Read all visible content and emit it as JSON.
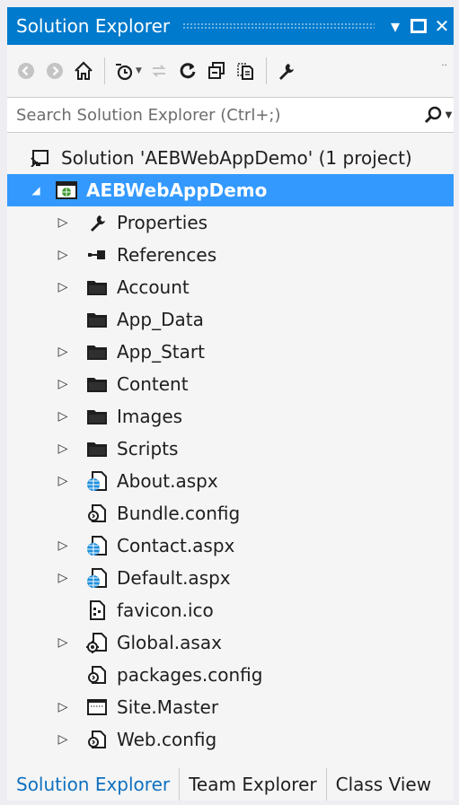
{
  "window": {
    "title": "Solution Explorer",
    "dropdown_glyph": "▾",
    "maximize_glyph": "☐",
    "close_glyph": "✕"
  },
  "search": {
    "placeholder": "Search Solution Explorer (Ctrl+;)"
  },
  "tree": {
    "solution": {
      "label": "Solution 'AEBWebAppDemo' (1 project)"
    },
    "project": {
      "label": "AEBWebAppDemo"
    },
    "items": [
      {
        "label": "Properties",
        "icon": "wrench-icon",
        "expandable": true
      },
      {
        "label": "References",
        "icon": "references-icon",
        "expandable": true
      },
      {
        "label": "Account",
        "icon": "folder-icon",
        "expandable": true
      },
      {
        "label": "App_Data",
        "icon": "folder-icon",
        "expandable": false
      },
      {
        "label": "App_Start",
        "icon": "folder-icon",
        "expandable": true
      },
      {
        "label": "Content",
        "icon": "folder-icon",
        "expandable": true
      },
      {
        "label": "Images",
        "icon": "folder-icon",
        "expandable": true
      },
      {
        "label": "Scripts",
        "icon": "folder-icon",
        "expandable": true
      },
      {
        "label": "About.aspx",
        "icon": "web-page-icon",
        "expandable": true
      },
      {
        "label": "Bundle.config",
        "icon": "config-file-icon",
        "expandable": false
      },
      {
        "label": "Contact.aspx",
        "icon": "web-page-icon",
        "expandable": true
      },
      {
        "label": "Default.aspx",
        "icon": "web-page-icon",
        "expandable": true
      },
      {
        "label": "favicon.ico",
        "icon": "image-file-icon",
        "expandable": false
      },
      {
        "label": "Global.asax",
        "icon": "global-file-icon",
        "expandable": true
      },
      {
        "label": "packages.config",
        "icon": "config-file-icon",
        "expandable": false
      },
      {
        "label": "Site.Master",
        "icon": "master-page-icon",
        "expandable": true
      },
      {
        "label": "Web.config",
        "icon": "config-file-icon",
        "expandable": true
      }
    ]
  },
  "tabs": [
    {
      "label": "Solution Explorer",
      "active": true
    },
    {
      "label": "Team Explorer",
      "active": false
    },
    {
      "label": "Class View",
      "active": false
    }
  ],
  "colors": {
    "accent": "#007acc",
    "selection": "#3399ff",
    "active_tab": "#0e70c0"
  }
}
